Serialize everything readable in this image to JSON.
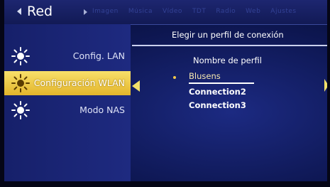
{
  "header": {
    "title": "Red",
    "tabs": [
      "Imagen",
      "Música",
      "Vídeo",
      "TDT",
      "Radio",
      "Web",
      "Ajustes"
    ]
  },
  "sidebar": {
    "items": [
      {
        "label": "Config. LAN",
        "icon": "sun-icon",
        "selected": false
      },
      {
        "label": "Configuración WLAN",
        "icon": "sun-icon",
        "selected": true
      },
      {
        "label": "Modo NAS",
        "icon": "sun-icon",
        "selected": false
      }
    ]
  },
  "main": {
    "title": "Elegir un perfil de conexión",
    "column_header": "Nombre de perfil",
    "profiles": [
      "Blusens",
      "Connection2",
      "Connection3"
    ],
    "selected_profile": "Blusens"
  },
  "colors": {
    "selection": "#f0c93a",
    "background": "#0d1650",
    "sidebar": "#1e2a80"
  }
}
